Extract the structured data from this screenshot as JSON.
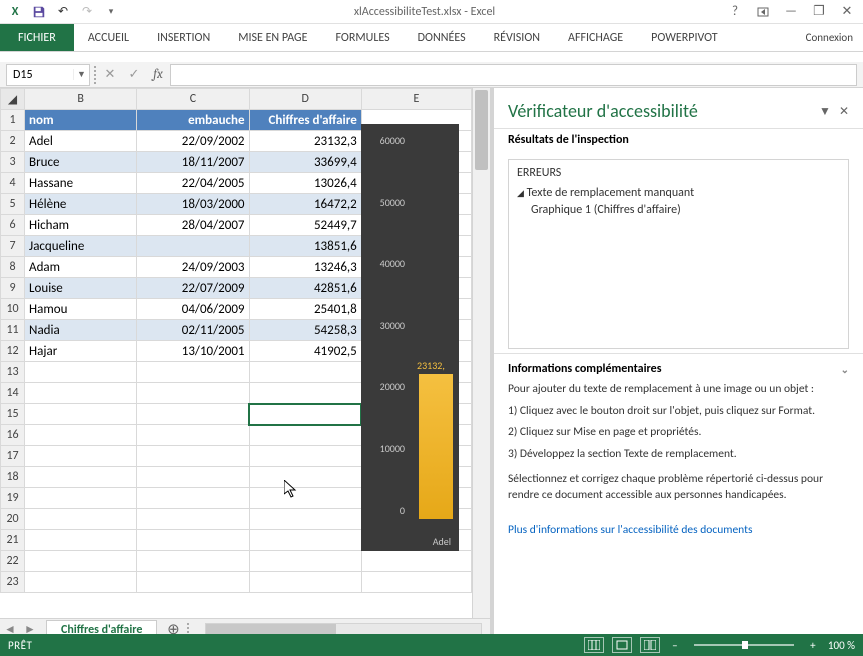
{
  "title": "xlAccessibiliteTest.xlsx - Excel",
  "qat": {
    "excel": "X",
    "save": "save"
  },
  "window": {
    "help": "?",
    "ribbon_opts": "",
    "min": "—",
    "restore": "❐",
    "close": "✕"
  },
  "ribbon": {
    "file": "FICHIER",
    "tabs": [
      "ACCUEIL",
      "INSERTION",
      "MISE EN PAGE",
      "FORMULES",
      "DONNÉES",
      "RÉVISION",
      "AFFICHAGE",
      "POWERPIVOT"
    ],
    "connexion": "Connexion"
  },
  "name_box": "D15",
  "formula_btns": {
    "cancel": "✕",
    "accept": "✓",
    "fx": "fx"
  },
  "columns": [
    "B",
    "C",
    "D",
    "E"
  ],
  "headers": {
    "nom": "nom",
    "embauche": "embauche",
    "ca": "Chiffres d'affaire"
  },
  "rows": [
    {
      "n": "1"
    },
    {
      "n": "2",
      "nom": "Adel",
      "date": "22/09/2002",
      "val": "23132,3"
    },
    {
      "n": "3",
      "nom": "Bruce",
      "date": "18/11/2007",
      "val": "33699,4"
    },
    {
      "n": "4",
      "nom": "Hassane",
      "date": "22/04/2005",
      "val": "13026,4"
    },
    {
      "n": "5",
      "nom": "Hélène",
      "date": "18/03/2000",
      "val": "16472,2"
    },
    {
      "n": "6",
      "nom": "Hicham",
      "date": "28/04/2007",
      "val": "52449,7"
    },
    {
      "n": "7",
      "nom": "Jacqueline",
      "date": "",
      "val": "13851,6"
    },
    {
      "n": "8",
      "nom": "Adam",
      "date": "24/09/2003",
      "val": "13246,3"
    },
    {
      "n": "9",
      "nom": "Louise",
      "date": "22/07/2009",
      "val": "42851,6"
    },
    {
      "n": "10",
      "nom": "Hamou",
      "date": "04/06/2009",
      "val": "25401,8"
    },
    {
      "n": "11",
      "nom": "Nadia",
      "date": "02/11/2005",
      "val": "54258,3"
    },
    {
      "n": "12",
      "nom": "Hajar",
      "date": "13/10/2001",
      "val": "41902,5"
    },
    {
      "n": "13"
    },
    {
      "n": "14"
    },
    {
      "n": "15"
    },
    {
      "n": "16"
    },
    {
      "n": "17"
    },
    {
      "n": "18"
    },
    {
      "n": "19"
    },
    {
      "n": "20"
    },
    {
      "n": "21"
    },
    {
      "n": "22"
    },
    {
      "n": "23"
    }
  ],
  "chart_data": {
    "type": "bar",
    "categories": [
      "Adel"
    ],
    "values": [
      23132.3
    ],
    "title": "",
    "xlabel": "",
    "ylabel": "",
    "ylim": [
      0,
      60000
    ],
    "yticks": [
      0,
      10000,
      20000,
      30000,
      40000,
      50000,
      60000
    ],
    "bar_label": "23132,"
  },
  "sheet_tab": "Chiffres d'affaire",
  "pane": {
    "title": "Vérificateur d'accessibilité",
    "results": "Résultats de l'inspection",
    "errors_label": "ERREURS",
    "error1": "Texte de remplacement manquant",
    "error1_sub": "Graphique 1 (Chiffres d'affaire)",
    "info_head": "Informations complémentaires",
    "info_intro": "Pour ajouter du texte de remplacement à une image ou un objet :",
    "info_1": "1) Cliquez avec le bouton droit sur l'objet, puis cliquez sur Format.",
    "info_2": "2) Cliquez sur Mise en page et propriétés.",
    "info_3": "3) Développez la section Texte de remplacement.",
    "info_foot": "Sélectionnez et corrigez chaque problème répertorié ci-dessus pour rendre ce document accessible aux personnes handicapées.",
    "link": "Plus d'informations sur l'accessibilité des documents"
  },
  "status": {
    "ready": "PRÊT",
    "zoom": "100 %"
  }
}
